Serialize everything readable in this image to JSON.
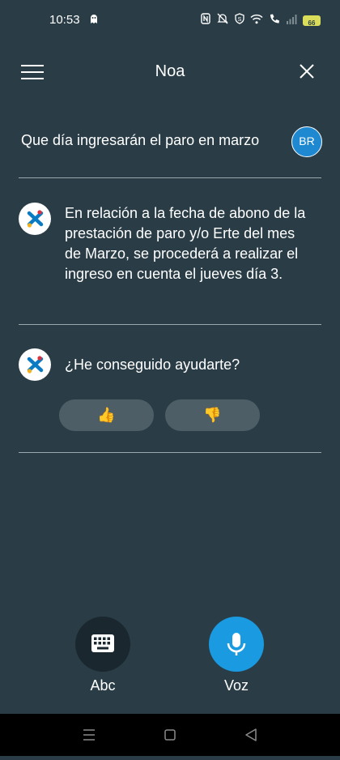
{
  "status_bar": {
    "time": "10:53",
    "battery_level": "66",
    "icons": [
      "ghost-icon",
      "nfc-icon",
      "mute-icon",
      "shield-icon",
      "wifi-icon",
      "call-icon",
      "signal-icon",
      "battery-icon"
    ]
  },
  "header": {
    "title": "Noa"
  },
  "conversation": {
    "user_message": "Que día ingresarán el paro en marzo",
    "user_initials": "BR",
    "bot_answer": "En relación a la fecha de abono de la prestación de paro y/o Erte del mes de Marzo, se procederá a realizar el ingreso en cuenta el jueves día 3.",
    "bot_question": "¿He conseguido ayudarte?",
    "thumbs_up": "👍",
    "thumbs_down": "👎"
  },
  "input_modes": {
    "keyboard_label": "Abc",
    "voice_label": "Voz"
  },
  "colors": {
    "background": "#2a3d47",
    "avatar": "#1e88d1",
    "voice_button": "#1a9ae0",
    "keyboard_button": "#1a272e",
    "feedback_button": "#4d5e67",
    "logo_blue": "#0a7bc2",
    "logo_red": "#e2303d",
    "logo_yellow": "#f6b21a"
  }
}
